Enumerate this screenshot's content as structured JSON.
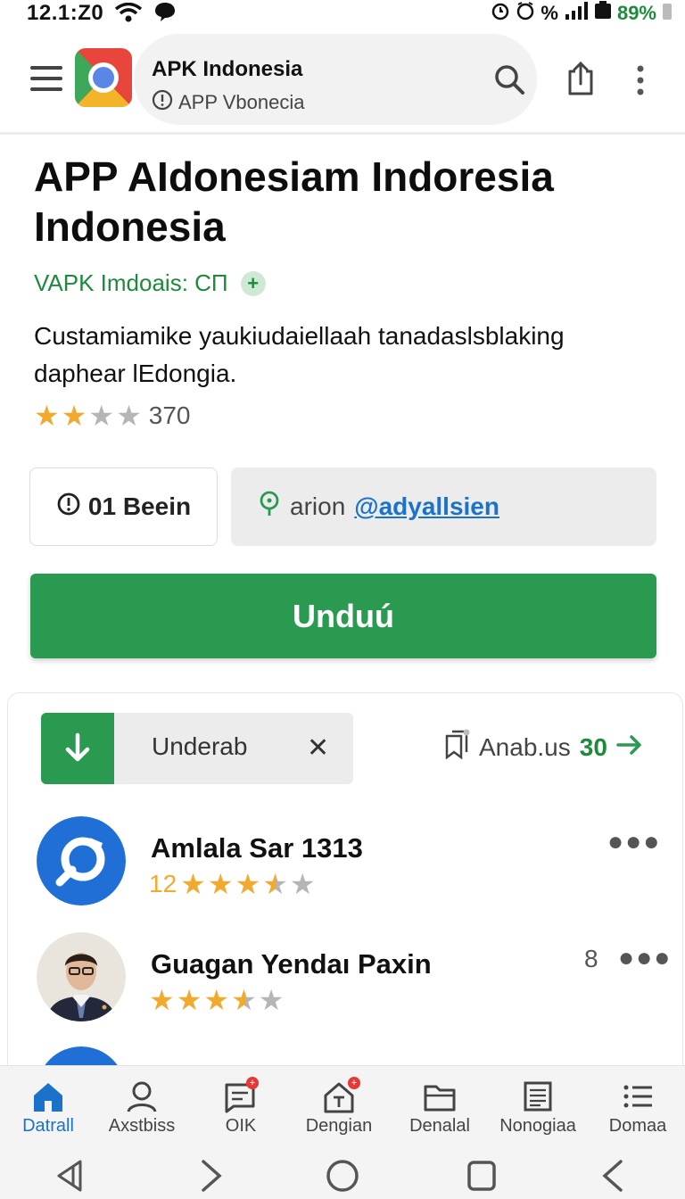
{
  "status_bar": {
    "time": "12.1:Z0",
    "battery": "89%",
    "icons": [
      "wifi-icon",
      "chat-icon",
      "alarm-icon",
      "alarm-icon",
      "percent-icon",
      "signal-icon",
      "battery-icon"
    ]
  },
  "browser": {
    "tab_title": "APK Indonesia",
    "url": "APP Vbonecia",
    "icons": [
      "hamburger-menu-icon",
      "chrome-icon",
      "info-icon",
      "search-icon",
      "share-icon",
      "more-vertical-icon"
    ]
  },
  "page": {
    "title": "APP AIdonesiam Indoresia Indonesia",
    "subtitle": "VAPK Imdoais: CП",
    "subtitle_badge": "+",
    "description": "Custamiamike yaukiudaiellaah tanadaslsblaking daphear lEdongia.",
    "rating": {
      "value": 2,
      "max": 4,
      "count": "370"
    },
    "info_chip": "01 Beein",
    "location": {
      "prefix": "arion",
      "link": "@adyallsien"
    },
    "download_button": "Unduú"
  },
  "card": {
    "download_chip_label": "Underab",
    "close_symbol": "✕",
    "anab_label": "Anab.us",
    "anab_count": "30",
    "items": [
      {
        "name": "Amlala Sar 1313",
        "rating_prefix": "12",
        "rating": 3.5,
        "count": "",
        "avatar": "app-logo-icon"
      },
      {
        "name": "Guagan Yendaı Paxin",
        "rating_prefix": "",
        "rating": 3.5,
        "count": "8",
        "avatar": "person-photo"
      },
      {
        "name": "",
        "rating_prefix": "",
        "rating": 0,
        "count": "",
        "avatar": "app-logo-icon"
      }
    ]
  },
  "bottom_nav": [
    {
      "label": "Datrall",
      "icon": "home-icon",
      "active": true
    },
    {
      "label": "Axstbiss",
      "icon": "person-icon",
      "active": false
    },
    {
      "label": "OIK",
      "icon": "chat-box-icon",
      "active": false,
      "badge": true
    },
    {
      "label": "Dengian",
      "icon": "text-house-icon",
      "active": false,
      "badge": true
    },
    {
      "label": "Denalal",
      "icon": "folder-icon",
      "active": false
    },
    {
      "label": "Nonogiaa",
      "icon": "document-icon",
      "active": false
    },
    {
      "label": "Domaa",
      "icon": "list-icon",
      "active": false
    }
  ],
  "colors": {
    "accent_green": "#2b9a51",
    "link_blue": "#1a73c8",
    "star": "#f2aa2e"
  }
}
